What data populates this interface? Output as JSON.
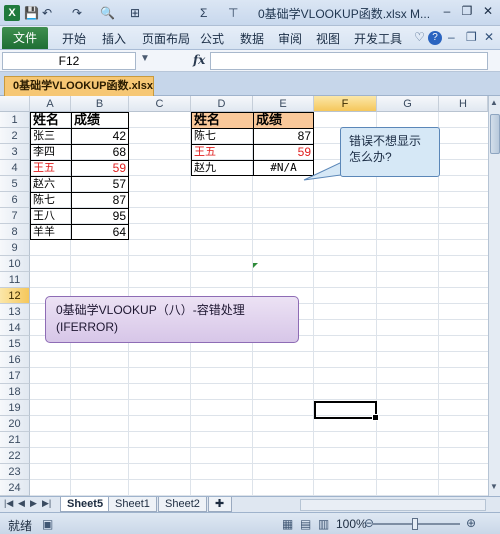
{
  "window": {
    "title": "0基础学VLOOKUP函数.xlsx M...",
    "quick_access": [
      "💾",
      "↶",
      "↷",
      "🔍",
      "⊞",
      "Σ",
      "⊤"
    ],
    "controls": {
      "minimize": "–",
      "restore": "❐",
      "close": "✕"
    }
  },
  "ribbon": {
    "file_tab": "文件",
    "tabs": [
      "开始",
      "插入",
      "页面布局",
      "公式",
      "数据",
      "审阅",
      "视图",
      "开发工具"
    ]
  },
  "formula_bar": {
    "name_box": "F12",
    "fx": "fx",
    "formula": ""
  },
  "workbook_tab": "0基础学VLOOKUP函数.xlsx",
  "grid": {
    "columns": [
      "A",
      "B",
      "C",
      "D",
      "E",
      "F",
      "G",
      "H"
    ],
    "selected_column": "F",
    "rows": [
      "1",
      "2",
      "3",
      "4",
      "5",
      "6",
      "7",
      "8",
      "9",
      "10",
      "11",
      "12",
      "13",
      "14",
      "15",
      "16",
      "17",
      "18",
      "19",
      "20",
      "21",
      "22",
      "23",
      "24"
    ],
    "selected_row": "12"
  },
  "table_left": {
    "header_name": "姓名",
    "header_score": "成绩",
    "rows": [
      {
        "name": "张三",
        "score": "42",
        "red": false
      },
      {
        "name": "李四",
        "score": "68",
        "red": false
      },
      {
        "name": "王五",
        "score": "59",
        "red": true
      },
      {
        "name": "赵六",
        "score": "57",
        "red": false
      },
      {
        "name": "陈七",
        "score": "87",
        "red": false
      },
      {
        "name": "王八",
        "score": "95",
        "red": false
      },
      {
        "name": "羊羊",
        "score": "64",
        "red": false
      }
    ]
  },
  "table_right": {
    "header_name": "姓名",
    "header_score": "成绩",
    "rows": [
      {
        "name": "陈七",
        "score": "87",
        "red": false
      },
      {
        "name": "王五",
        "score": "59",
        "red": true
      },
      {
        "name": "赵九",
        "score": "#N/A",
        "red": false
      }
    ]
  },
  "callout": {
    "line1": "错误不想显示",
    "line2": "怎么办?"
  },
  "note": {
    "line1": "0基础学VLOOKUP（八）-容错处理",
    "line2": "(IFERROR)"
  },
  "sheets": [
    "Sheet5",
    "Sheet1",
    "Sheet2"
  ],
  "active_sheet": "Sheet5",
  "status": {
    "ready": "就绪",
    "zoom": "100%"
  },
  "colors": {
    "header_fill": "#f9c89a",
    "red_text": "#e02020",
    "selection": "#f5c75b",
    "file_tab": "#1f6f34"
  }
}
